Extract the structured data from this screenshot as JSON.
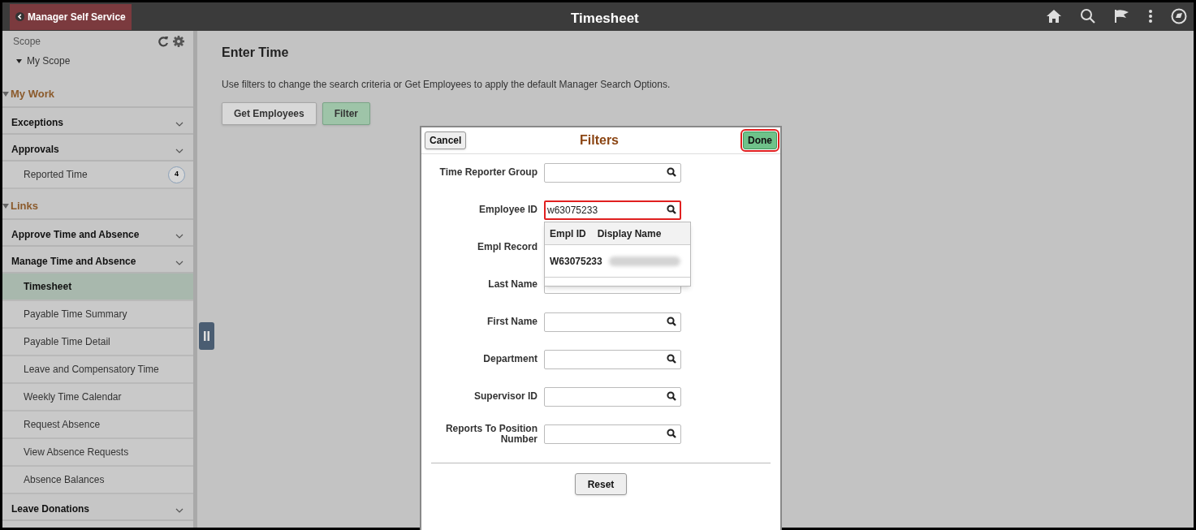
{
  "header": {
    "back_label": "Manager Self Service",
    "title": "Timesheet"
  },
  "sidebar": {
    "scope": {
      "title": "Scope",
      "items": [
        {
          "label": "My Scope"
        }
      ]
    },
    "sections": [
      {
        "label": "My Work",
        "expanded": true,
        "children": [
          {
            "label": "Exceptions"
          },
          {
            "label": "Approvals",
            "children": [
              {
                "label": "Reported Time",
                "badge": "4",
                "selected": false
              }
            ]
          }
        ]
      },
      {
        "label": "Links",
        "expanded": true,
        "children": [
          {
            "label": "Approve Time and Absence"
          },
          {
            "label": "Manage Time and Absence",
            "children": [
              {
                "label": "Timesheet",
                "selected": true
              },
              {
                "label": "Payable Time Summary",
                "selected": false
              },
              {
                "label": "Payable Time Detail",
                "selected": false
              },
              {
                "label": "Leave and Compensatory Time",
                "selected": false
              },
              {
                "label": "Weekly Time Calendar",
                "selected": false
              },
              {
                "label": "Request Absence",
                "selected": false
              },
              {
                "label": "View Absence Requests",
                "selected": false
              },
              {
                "label": "Absence Balances",
                "selected": false
              }
            ]
          },
          {
            "label": "Leave Donations"
          }
        ]
      }
    ]
  },
  "main": {
    "title": "Enter Time",
    "instructions": "Use filters to change the search criteria or Get Employees to apply the default Manager Search Options.",
    "buttons": [
      {
        "label": "Get Employees",
        "kind": "default"
      },
      {
        "label": "Filter",
        "kind": "primary"
      }
    ]
  },
  "filters_dialog": {
    "title": "Filters",
    "cancel": {
      "label": "Cancel",
      "highlighted": false
    },
    "done": {
      "label": "Done",
      "highlighted": true
    },
    "fields": [
      {
        "label": "Time Reporter Group",
        "kind": "lookup",
        "highlighted": false
      },
      {
        "label": "Employee ID",
        "kind": "lookup",
        "value": "w63075233",
        "highlighted": true
      },
      {
        "label": "Empl Record",
        "kind": "hidden"
      },
      {
        "label": "Last Name",
        "kind": "partial"
      },
      {
        "label": "First Name",
        "kind": "lookup",
        "highlighted": false
      },
      {
        "label": "Department",
        "kind": "lookup",
        "highlighted": false
      },
      {
        "label": "Supervisor ID",
        "kind": "lookup",
        "highlighted": false
      },
      {
        "label": "Reports To Position Number",
        "kind": "lookup",
        "highlighted": false
      }
    ],
    "suggestions": {
      "columns": [
        "Empl ID",
        "Display Name"
      ],
      "rows": [
        {
          "empl_id": "W63075233",
          "display_name_redacted": true
        }
      ]
    },
    "reset": "Reset"
  }
}
